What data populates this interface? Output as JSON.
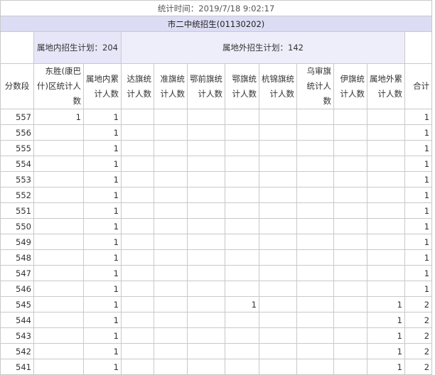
{
  "stat_time": "统计时间：2019/7/18 9:02:17",
  "school": "市二中统招生(01130202)",
  "plan_in": "属地内招生计划：204",
  "plan_out": "属地外招生计划：142",
  "headers": {
    "score": "分数段",
    "dongsheng": "东胜(康巴什)区统计人数",
    "local_cum": "属地内累计人数",
    "dala": "达旗统计人数",
    "zhun": "准旗统计人数",
    "eqian": "鄂前旗统计人数",
    "e": "鄂旗统计人数",
    "hangjin": "杭锦旗统计人数",
    "wushen": "乌审旗统计人数",
    "yi": "伊旗统计人数",
    "out_cum": "属地外累计人数",
    "total": "合计"
  },
  "rows": [
    {
      "score": "557",
      "dongsheng": "1",
      "local_cum": "1",
      "dala": "",
      "zhun": "",
      "eqian": "",
      "e": "",
      "hangjin": "",
      "wushen": "",
      "yi": "",
      "out_cum": "",
      "total": "1"
    },
    {
      "score": "556",
      "dongsheng": "",
      "local_cum": "1",
      "dala": "",
      "zhun": "",
      "eqian": "",
      "e": "",
      "hangjin": "",
      "wushen": "",
      "yi": "",
      "out_cum": "",
      "total": "1"
    },
    {
      "score": "555",
      "dongsheng": "",
      "local_cum": "1",
      "dala": "",
      "zhun": "",
      "eqian": "",
      "e": "",
      "hangjin": "",
      "wushen": "",
      "yi": "",
      "out_cum": "",
      "total": "1"
    },
    {
      "score": "554",
      "dongsheng": "",
      "local_cum": "1",
      "dala": "",
      "zhun": "",
      "eqian": "",
      "e": "",
      "hangjin": "",
      "wushen": "",
      "yi": "",
      "out_cum": "",
      "total": "1"
    },
    {
      "score": "553",
      "dongsheng": "",
      "local_cum": "1",
      "dala": "",
      "zhun": "",
      "eqian": "",
      "e": "",
      "hangjin": "",
      "wushen": "",
      "yi": "",
      "out_cum": "",
      "total": "1"
    },
    {
      "score": "552",
      "dongsheng": "",
      "local_cum": "1",
      "dala": "",
      "zhun": "",
      "eqian": "",
      "e": "",
      "hangjin": "",
      "wushen": "",
      "yi": "",
      "out_cum": "",
      "total": "1"
    },
    {
      "score": "551",
      "dongsheng": "",
      "local_cum": "1",
      "dala": "",
      "zhun": "",
      "eqian": "",
      "e": "",
      "hangjin": "",
      "wushen": "",
      "yi": "",
      "out_cum": "",
      "total": "1"
    },
    {
      "score": "550",
      "dongsheng": "",
      "local_cum": "1",
      "dala": "",
      "zhun": "",
      "eqian": "",
      "e": "",
      "hangjin": "",
      "wushen": "",
      "yi": "",
      "out_cum": "",
      "total": "1"
    },
    {
      "score": "549",
      "dongsheng": "",
      "local_cum": "1",
      "dala": "",
      "zhun": "",
      "eqian": "",
      "e": "",
      "hangjin": "",
      "wushen": "",
      "yi": "",
      "out_cum": "",
      "total": "1"
    },
    {
      "score": "548",
      "dongsheng": "",
      "local_cum": "1",
      "dala": "",
      "zhun": "",
      "eqian": "",
      "e": "",
      "hangjin": "",
      "wushen": "",
      "yi": "",
      "out_cum": "",
      "total": "1"
    },
    {
      "score": "547",
      "dongsheng": "",
      "local_cum": "1",
      "dala": "",
      "zhun": "",
      "eqian": "",
      "e": "",
      "hangjin": "",
      "wushen": "",
      "yi": "",
      "out_cum": "",
      "total": "1"
    },
    {
      "score": "546",
      "dongsheng": "",
      "local_cum": "1",
      "dala": "",
      "zhun": "",
      "eqian": "",
      "e": "",
      "hangjin": "",
      "wushen": "",
      "yi": "",
      "out_cum": "",
      "total": "1"
    },
    {
      "score": "545",
      "dongsheng": "",
      "local_cum": "1",
      "dala": "",
      "zhun": "",
      "eqian": "",
      "e": "1",
      "hangjin": "",
      "wushen": "",
      "yi": "",
      "out_cum": "1",
      "total": "2"
    },
    {
      "score": "544",
      "dongsheng": "",
      "local_cum": "1",
      "dala": "",
      "zhun": "",
      "eqian": "",
      "e": "",
      "hangjin": "",
      "wushen": "",
      "yi": "",
      "out_cum": "1",
      "total": "2"
    },
    {
      "score": "543",
      "dongsheng": "",
      "local_cum": "1",
      "dala": "",
      "zhun": "",
      "eqian": "",
      "e": "",
      "hangjin": "",
      "wushen": "",
      "yi": "",
      "out_cum": "1",
      "total": "2"
    },
    {
      "score": "542",
      "dongsheng": "",
      "local_cum": "1",
      "dala": "",
      "zhun": "",
      "eqian": "",
      "e": "",
      "hangjin": "",
      "wushen": "",
      "yi": "",
      "out_cum": "1",
      "total": "2"
    },
    {
      "score": "541",
      "dongsheng": "",
      "local_cum": "1",
      "dala": "",
      "zhun": "",
      "eqian": "",
      "e": "",
      "hangjin": "",
      "wushen": "",
      "yi": "",
      "out_cum": "1",
      "total": "2"
    }
  ]
}
